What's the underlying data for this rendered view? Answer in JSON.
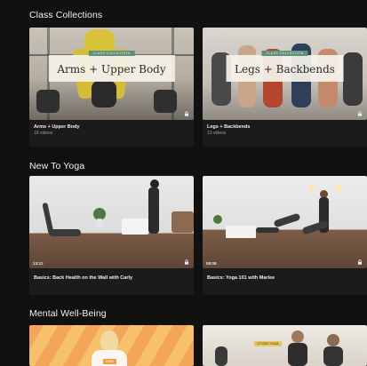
{
  "sections": [
    {
      "title": "Class Collections"
    },
    {
      "title": "New To Yoga"
    },
    {
      "title": "Mental Well-Being"
    }
  ],
  "collections": [
    {
      "tag": "CLASS COLLECTION",
      "overlay": "Arms + Upper Body",
      "title": "Arms + Upper Body",
      "count": "18 videos"
    },
    {
      "tag": "CLASS COLLECTION",
      "overlay": "Legs + Backbends",
      "title": "Legs + Backbends",
      "count": "13 videos"
    }
  ],
  "new_to_yoga": [
    {
      "duration": "13:12",
      "title": "Basics: Back Health on the Wall with Carly"
    },
    {
      "duration": "08:08",
      "title": "Basics: Yoga 101 with Marlee"
    }
  ],
  "mental": [
    {
      "badge": "MIND"
    },
    {
      "badge": "CITIZEN YOGA"
    }
  ],
  "colors": {
    "background": "#111111",
    "tag": "#5e8f78",
    "floor": "#6a4d3c"
  }
}
